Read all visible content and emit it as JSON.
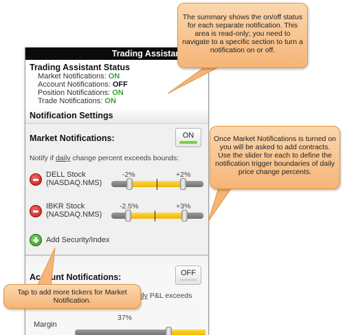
{
  "titlebar": {
    "title": "Trading Assistant"
  },
  "status": {
    "heading": "Trading Assistant Status",
    "rows": [
      {
        "label": "Market Notifications:",
        "value": "ON"
      },
      {
        "label": "Account Notifications:",
        "value": "OFF"
      },
      {
        "label": "Position Notifications:",
        "value": "ON"
      },
      {
        "label": "Trade Notifications:",
        "value": "ON"
      }
    ]
  },
  "settings_header": "Notification Settings",
  "market": {
    "title": "Market Notifications:",
    "toggle": "ON",
    "notify_prefix": "Notify if ",
    "notify_underlined": "daily",
    "notify_suffix": " change percent exceeds bounds:",
    "stocks": [
      {
        "name": "DELL Stock",
        "exchange": "(NASDAQ.NMS)",
        "low_label": "-2%",
        "high_label": "+2%"
      },
      {
        "name": "IBKR Stock",
        "exchange": "(NASDAQ.NMS)",
        "low_label": "-2.5%",
        "high_label": "+3%"
      }
    ],
    "add_label": "Add Security/Index"
  },
  "account": {
    "title": "Account Notifications:",
    "toggle": "OFF",
    "notify_fragment_underlined": "ily",
    "notify_fragment": " P&L exceeds",
    "margin_label_top": "Margin",
    "margin_value": "37%"
  },
  "callouts": {
    "summary": "The summary shows the on/off status for each separate notification. This area is read-only; you need to navigate to a specific section to turn a notification on or off.",
    "market": "Once Market Notifications is turned on you will be asked to add contracts. Use the slider for each to define the notification trigger boundaries of daily price change percents.",
    "tickers": "Tap to add more tickers for Market Notification."
  },
  "colors": {
    "on_green": "#3aa335",
    "callout_fill": "#f5b577",
    "slider_fill": "#f0b400"
  }
}
